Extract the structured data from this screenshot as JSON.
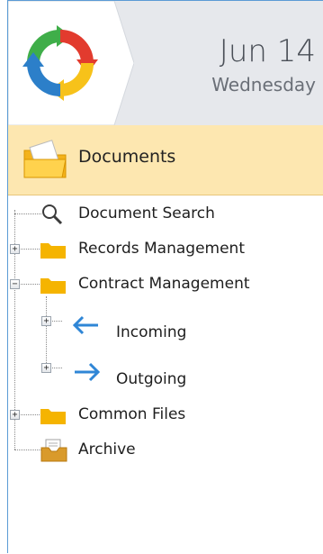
{
  "header": {
    "date": "Jun 14",
    "weekday": "Wednesday"
  },
  "section": {
    "label": "Documents",
    "icon": "documents-folder-icon"
  },
  "tree": {
    "document_search": "Document Search",
    "records_management": "Records Management",
    "contract_management": "Contract Management",
    "incoming": "Incoming",
    "outgoing": "Outgoing",
    "common_files": "Common Files",
    "archive": "Archive"
  },
  "colors": {
    "accent_border": "#5b9bd5",
    "section_bg": "#fde7b0",
    "folder": "#f5b400",
    "arrow": "#2f86d6"
  }
}
